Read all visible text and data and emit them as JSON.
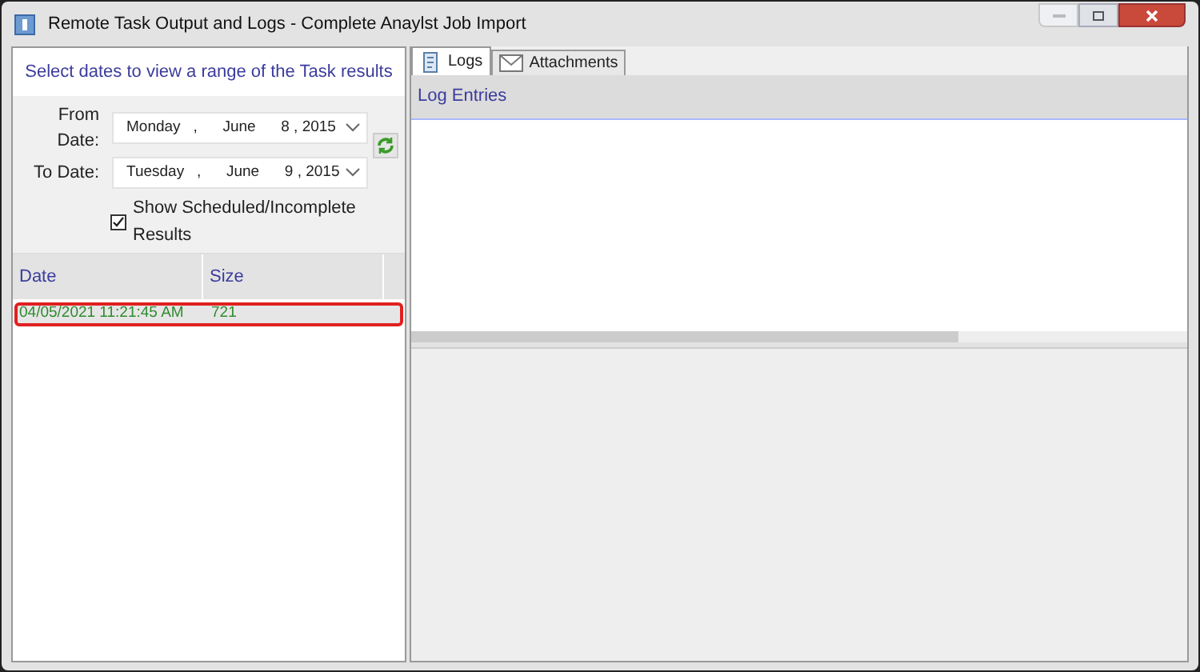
{
  "window": {
    "title": "Remote Task Output and Logs - Complete Anaylst Job Import"
  },
  "left_panel": {
    "heading": "Select dates to view a range of the Task results",
    "from_date": {
      "label": "From Date:",
      "value": "Monday   ,      June      8 , 2015"
    },
    "to_date": {
      "label": "To Date:",
      "value": "Tuesday   ,      June      9 , 2015"
    },
    "show_scheduled": {
      "label": "Show Scheduled/Incomplete Results",
      "checked": true
    },
    "table": {
      "columns": [
        "Date",
        "Size"
      ],
      "rows": [
        {
          "cells": [
            "04/05/2021 11:21:45 AM",
            "721"
          ],
          "selected": true
        }
      ]
    }
  },
  "tabs": [
    {
      "label": "Logs",
      "selected": true
    },
    {
      "label": "Attachments",
      "selected": false
    }
  ],
  "log_panel": {
    "header": "Log Entries"
  }
}
